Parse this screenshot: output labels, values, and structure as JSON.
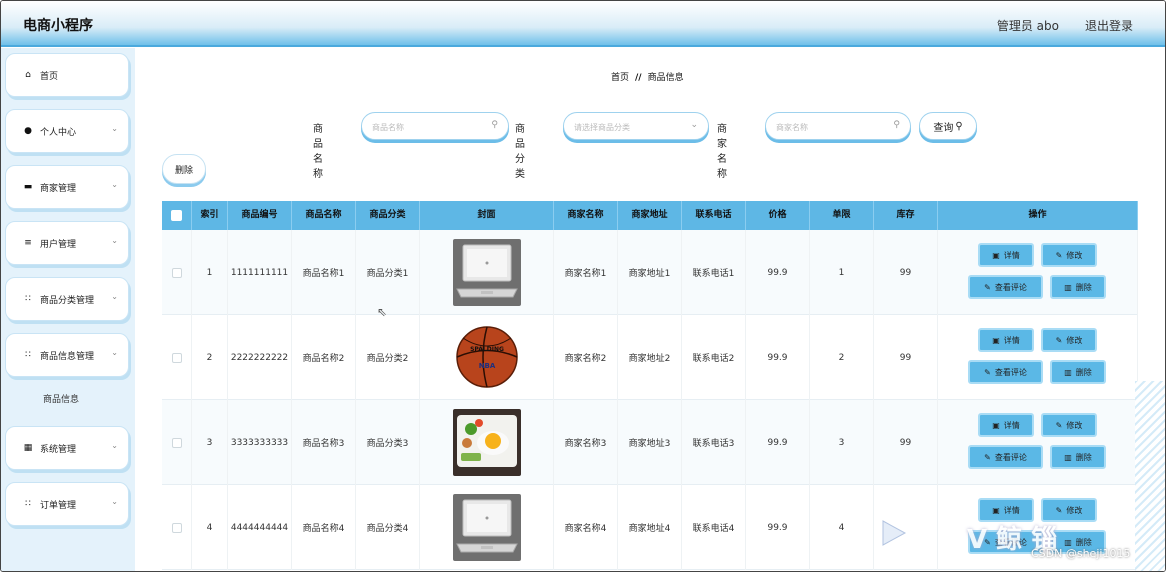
{
  "app": {
    "title": "电商小程序",
    "user": "管理员 abo",
    "logout": "退出登录"
  },
  "sidebar": {
    "items": [
      {
        "label": "首页",
        "icon": "home-icon",
        "glyph": "⌂",
        "expand": false
      },
      {
        "label": "个人中心",
        "icon": "person-icon",
        "glyph": "●",
        "expand": true
      },
      {
        "label": "商家管理",
        "icon": "shop-icon",
        "glyph": "▬",
        "expand": true
      },
      {
        "label": "用户管理",
        "icon": "list-icon",
        "glyph": "≡",
        "expand": true
      },
      {
        "label": "商品分类管理",
        "icon": "grid-icon",
        "glyph": "∷",
        "expand": true
      },
      {
        "label": "商品信息管理",
        "icon": "grid-icon",
        "glyph": "∷",
        "expand": true
      },
      {
        "label": "系统管理",
        "icon": "apps-icon",
        "glyph": "▦",
        "expand": true
      },
      {
        "label": "订单管理",
        "icon": "grid-icon",
        "glyph": "∷",
        "expand": true
      }
    ],
    "sub_item": "商品信息"
  },
  "breadcrumb": {
    "home": "首页",
    "sep": "//",
    "current": "商品信息"
  },
  "search": {
    "name_label": "商品名称",
    "name_placeholder": "商品名称",
    "category_label": "商品分类",
    "category_placeholder": "请选择商品分类",
    "merchant_label": "商家名称",
    "merchant_placeholder": "商家名称",
    "query_button": "查询"
  },
  "delete_button": "删除",
  "table": {
    "headers": [
      "索引",
      "商品编号",
      "商品名称",
      "商品分类",
      "封面",
      "商家名称",
      "商家地址",
      "联系电话",
      "价格",
      "单限",
      "库存",
      "操作"
    ],
    "rows": [
      {
        "index": "1",
        "code": "1111111111",
        "name": "商品名称1",
        "category": "商品分类1",
        "cover": "laptop",
        "merchant": "商家名称1",
        "address": "商家地址1",
        "phone": "联系电话1",
        "price": "99.9",
        "limit": "1",
        "stock": "99"
      },
      {
        "index": "2",
        "code": "2222222222",
        "name": "商品名称2",
        "category": "商品分类2",
        "cover": "basketball",
        "merchant": "商家名称2",
        "address": "商家地址2",
        "phone": "联系电话2",
        "price": "99.9",
        "limit": "2",
        "stock": "99"
      },
      {
        "index": "3",
        "code": "3333333333",
        "name": "商品名称3",
        "category": "商品分类3",
        "cover": "food",
        "merchant": "商家名称3",
        "address": "商家地址3",
        "phone": "联系电话3",
        "price": "99.9",
        "limit": "3",
        "stock": "99"
      },
      {
        "index": "4",
        "code": "4444444444",
        "name": "商品名称4",
        "category": "商品分类4",
        "cover": "laptop",
        "merchant": "商家名称4",
        "address": "商家地址4",
        "phone": "联系电话4",
        "price": "99.9",
        "limit": "4",
        "stock": ""
      }
    ],
    "actions": {
      "detail": "详情",
      "edit": "修改",
      "reviews": "查看评论",
      "delete": "删除"
    }
  },
  "ball_text": {
    "brand": "SPALDING",
    "league": "NBA"
  },
  "watermark": {
    "csdn": "CSDN @sheji1015",
    "overlay": "V 鲸 锱"
  },
  "colors": {
    "accent": "#5eb7e5",
    "header_bottom": "#4aa9dd",
    "sidebar_bg": "#e4f2fb"
  }
}
